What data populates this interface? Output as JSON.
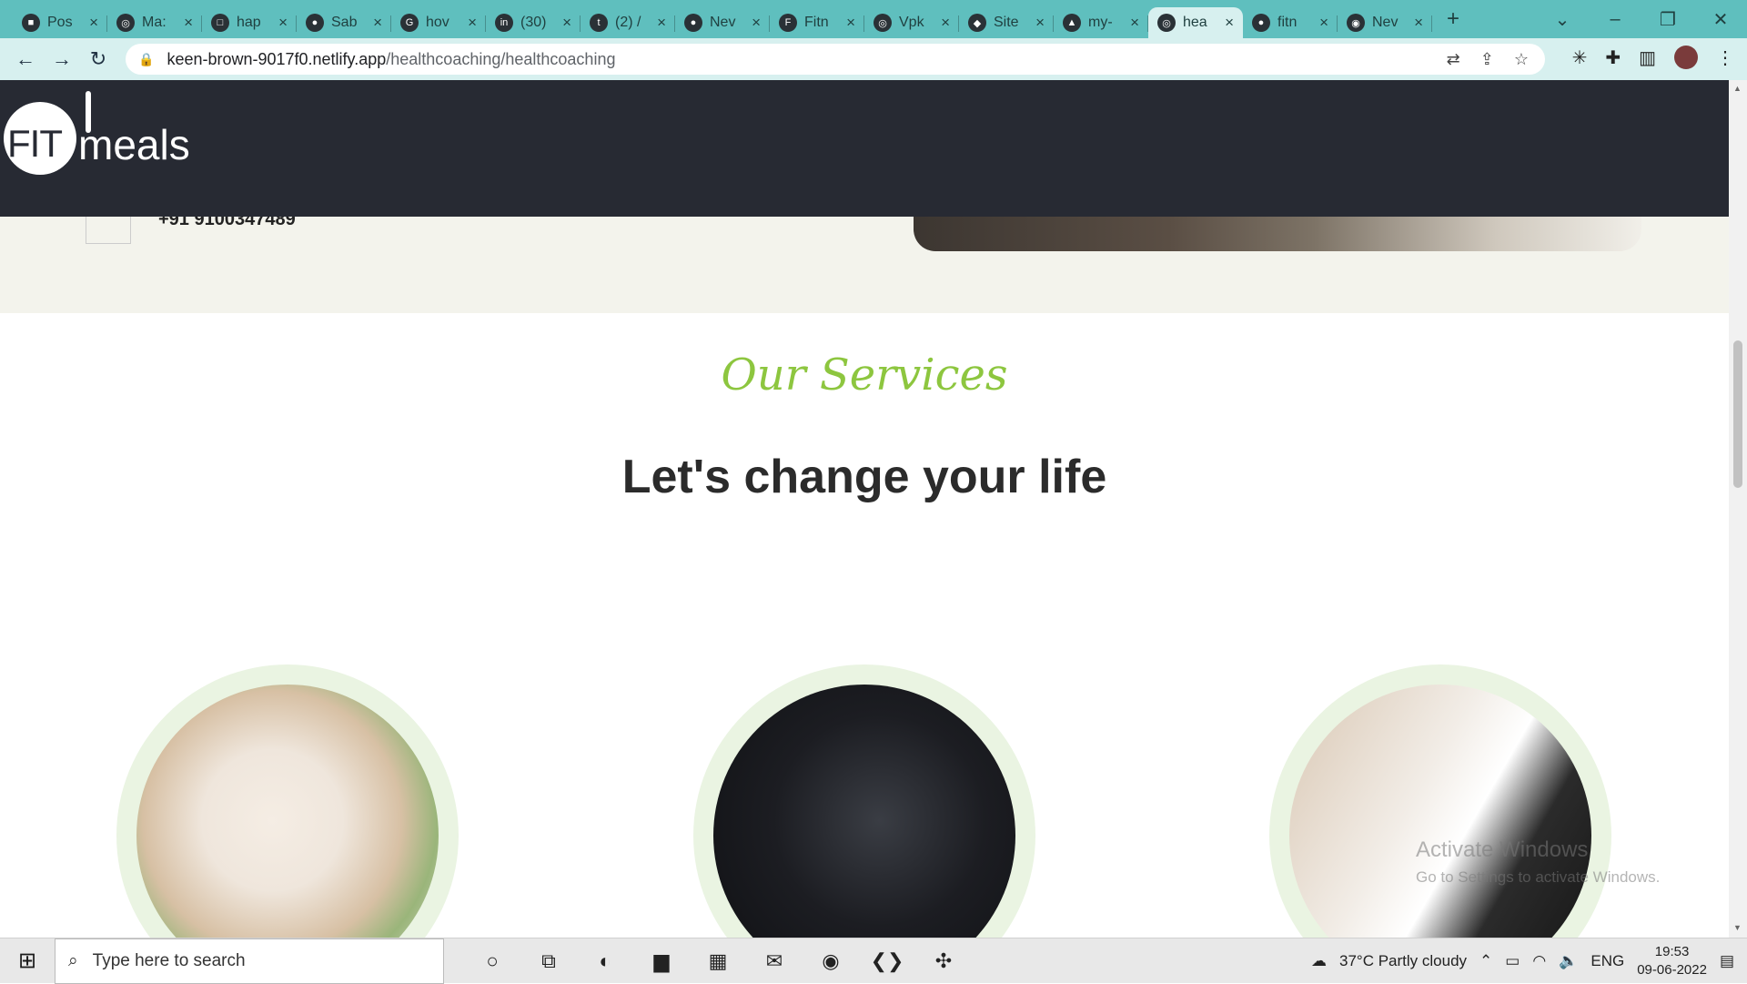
{
  "browser": {
    "tabs": [
      {
        "label": "Pos",
        "icon": "zoom-icon"
      },
      {
        "label": "Ma:",
        "icon": "globe-icon"
      },
      {
        "label": "hap",
        "icon": "square-icon"
      },
      {
        "label": "Sab",
        "icon": "github-icon"
      },
      {
        "label": "hov",
        "icon": "google-icon"
      },
      {
        "label": "(30)",
        "icon": "linkedin-icon"
      },
      {
        "label": "(2) /",
        "icon": "twitter-icon"
      },
      {
        "label": "Nev",
        "icon": "github-icon"
      },
      {
        "label": "Fitn",
        "icon": "fit-icon"
      },
      {
        "label": "Vpk",
        "icon": "globe-icon"
      },
      {
        "label": "Site",
        "icon": "netlify-icon"
      },
      {
        "label": "my-",
        "icon": "triangle-icon"
      },
      {
        "label": "hea",
        "icon": "globe-icon",
        "active": true
      },
      {
        "label": "fitn",
        "icon": "github-icon"
      },
      {
        "label": "Nev",
        "icon": "chrome-icon"
      }
    ],
    "url_host": "keen-brown-9017f0.netlify.app",
    "url_path": "/healthcoaching/healthcoaching"
  },
  "site": {
    "logo_fit": "FIT",
    "logo_meals": "meals",
    "phone": "+91 9100347489"
  },
  "services": {
    "subtitle": "Our Services",
    "headline": "Let's change your life",
    "cards": [
      "food-bowls-photo",
      "gym-leg-press-photo",
      "doctor-consultation-photo"
    ]
  },
  "watermark": {
    "title": "Activate Windows",
    "subtitle": "Go to Settings to activate Windows."
  },
  "taskbar": {
    "search_placeholder": "Type here to search",
    "weather": "37°C  Partly cloudy",
    "lang": "ENG",
    "time": "19:53",
    "date": "09-06-2022"
  }
}
